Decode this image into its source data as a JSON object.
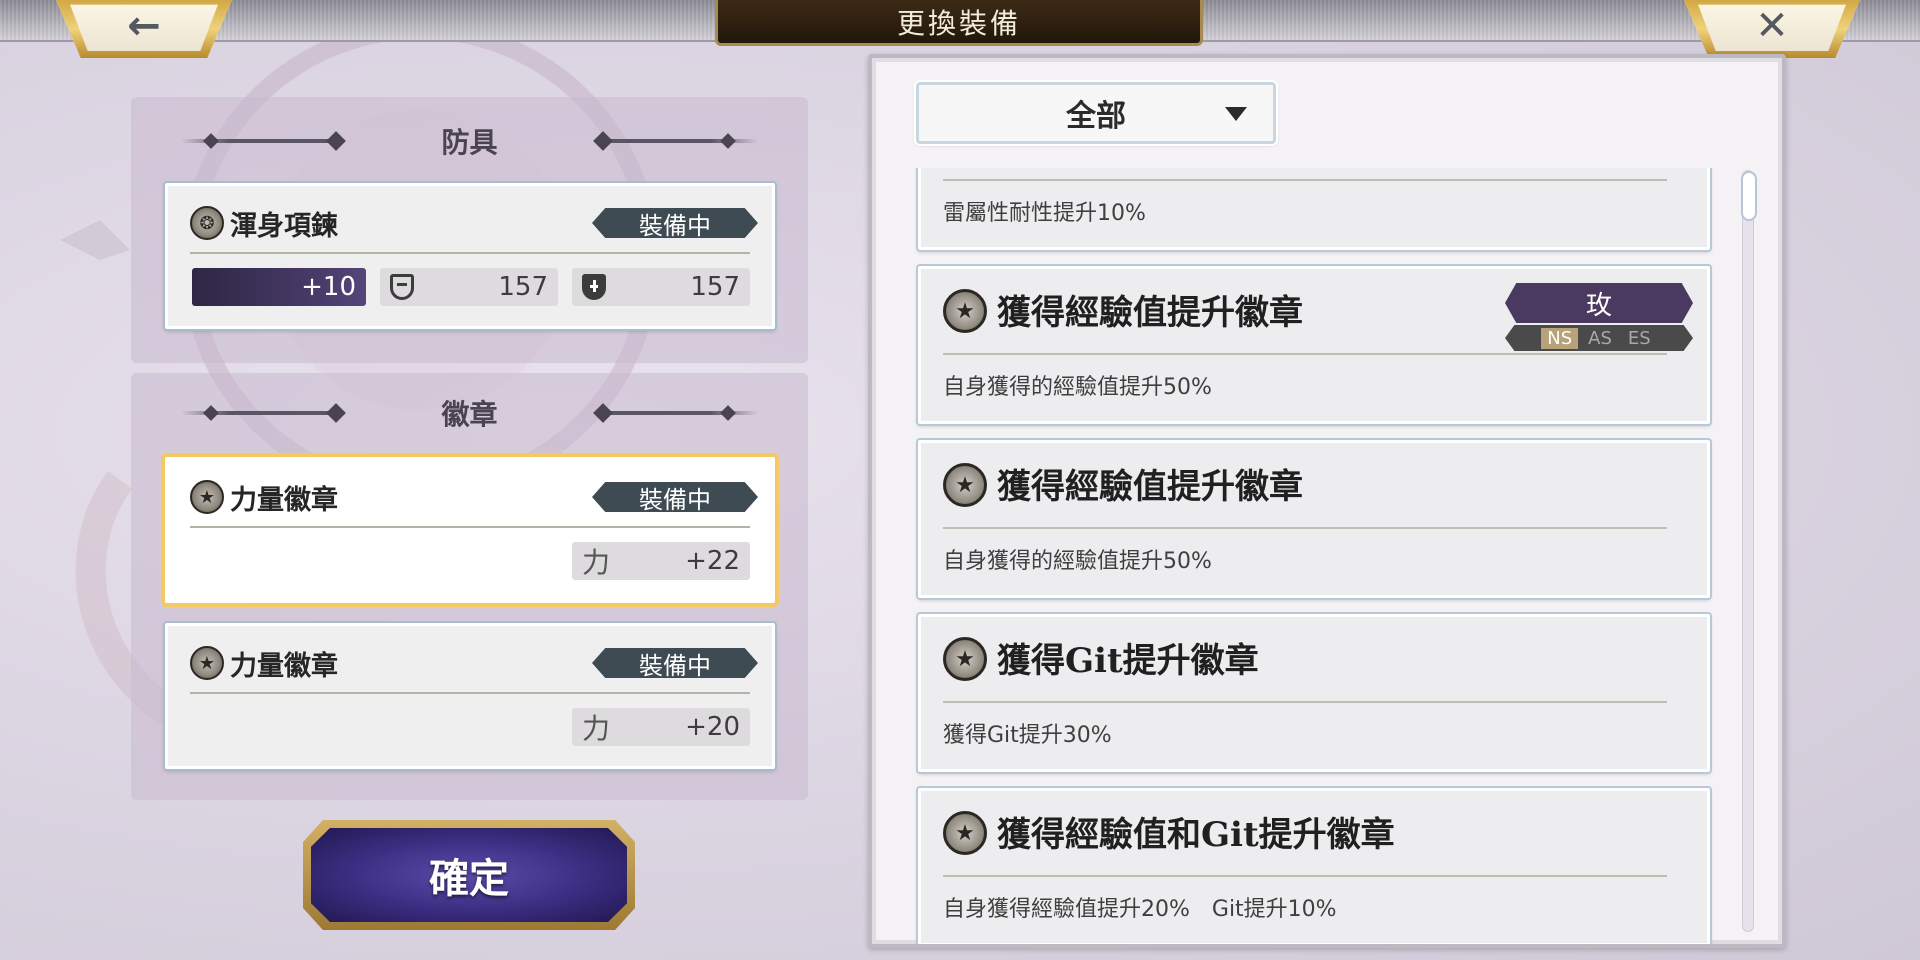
{
  "header": {
    "title": "更換裝備",
    "back_icon": "←",
    "close_icon": "✕"
  },
  "armor_section": {
    "title": "防具",
    "item": {
      "name": "渾身項鍊",
      "status": "裝備中",
      "level": "+10",
      "def": "157",
      "mdef": "157"
    }
  },
  "badge_section": {
    "title": "徽章",
    "items": [
      {
        "name": "力量徽章",
        "status": "裝備中",
        "stat_label": "力",
        "stat_value": "+22"
      },
      {
        "name": "力量徽章",
        "status": "裝備中",
        "stat_label": "力",
        "stat_value": "+20"
      }
    ]
  },
  "confirm_label": "確定",
  "list": {
    "filter": "全部",
    "items": [
      {
        "name": "",
        "desc": "雷屬性耐性提升10%"
      },
      {
        "name": "獲得經驗值提升徽章",
        "desc": "自身獲得的經驗值提升50%",
        "rank": "玫",
        "modes": [
          "NS",
          "AS",
          "ES"
        ]
      },
      {
        "name": "獲得經驗值提升徽章",
        "desc": "自身獲得的經驗值提升50%"
      },
      {
        "name": "獲得Git提升徽章",
        "desc": "獲得Git提升30%"
      },
      {
        "name": "獲得經驗值和Git提升徽章",
        "desc": "自身獲得經驗值提升20%　Git提升10%"
      }
    ]
  },
  "colors": {
    "equipped_tag": "#3f4b52",
    "rank_bg": "#4b3a60",
    "confirm_bg": "#3a2d80",
    "selected_border": "#f3c865"
  }
}
